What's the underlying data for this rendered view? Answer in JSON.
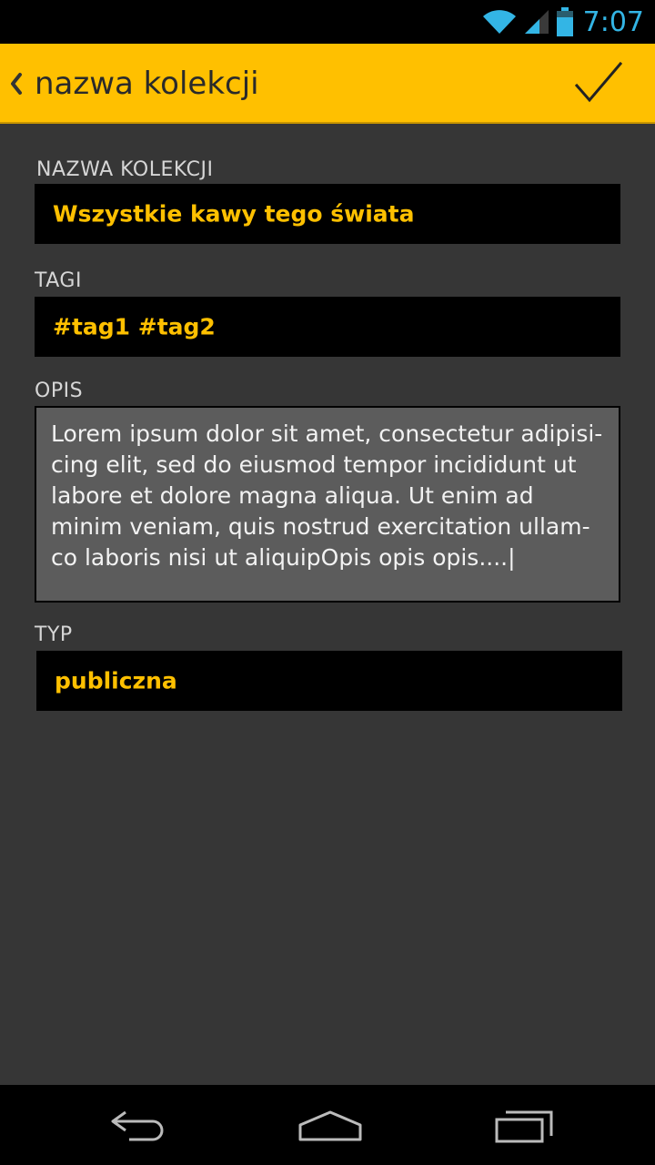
{
  "status_bar": {
    "time": "7:07",
    "icons": [
      "wifi-icon",
      "signal-icon",
      "battery-icon"
    ],
    "accent_color": "#33b5e5"
  },
  "action_bar": {
    "title": "nazwa kolekcji",
    "back_icon": "chevron-left-icon",
    "confirm_icon": "checkmark-icon",
    "color": "#ffc000"
  },
  "form": {
    "name": {
      "label": "NAZWA KOLEKCJI",
      "value": "Wszystkie kawy tego świata"
    },
    "tags": {
      "label": "TAGI",
      "value": "#tag1 #tag2"
    },
    "description": {
      "label": "OPIS",
      "value": "Lorem ipsum dolor sit amet, consectetur adipisi-cing elit, sed do eiusmod tempor incididunt ut labore et dolore magna aliqua. Ut enim ad minim veniam, quis nostrud exercitation ullam-co laboris nisi ut aliquipOpis opis opis....|"
    },
    "type": {
      "label": "TYP",
      "value": "publiczna"
    }
  },
  "nav_bar": {
    "icons": [
      "back-nav-icon",
      "home-nav-icon",
      "recents-nav-icon"
    ]
  }
}
